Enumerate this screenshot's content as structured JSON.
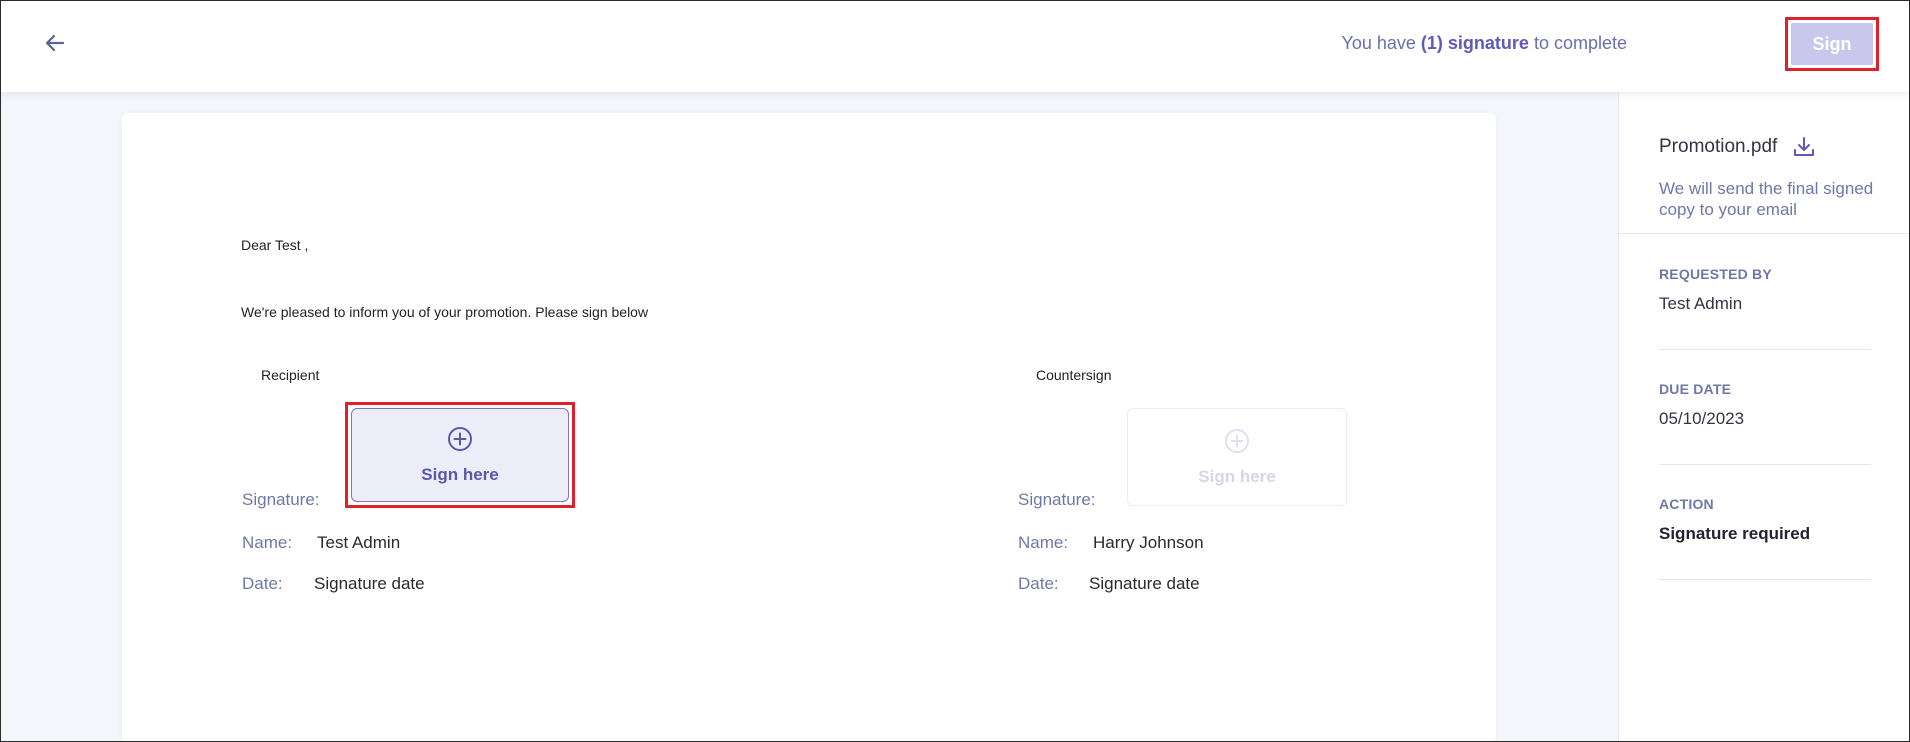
{
  "header": {
    "status_prefix": "You have ",
    "status_count": "(1) signature",
    "status_suffix": " to complete",
    "sign_button": "Sign"
  },
  "document": {
    "greeting": "Dear Test ,",
    "body": "We're pleased to inform you of your promotion. Please sign below",
    "recipient": {
      "title": "Recipient",
      "sign_here": "Sign here",
      "signature_label": "Signature:",
      "name_label": "Name:",
      "name_value": "Test Admin",
      "date_label": "Date:",
      "date_value": "Signature date"
    },
    "countersign": {
      "title": "Countersign",
      "sign_here": "Sign here",
      "signature_label": "Signature:",
      "name_label": "Name:",
      "name_value": "Harry Johnson",
      "date_label": "Date:",
      "date_value": "Signature date"
    }
  },
  "panel": {
    "file_name": "Promotion.pdf",
    "note": "We will send the final signed copy to your email",
    "requested_by_heading": "REQUESTED BY",
    "requested_by_value": "Test Admin",
    "due_date_heading": "DUE DATE",
    "due_date_value": "05/10/2023",
    "action_heading": "ACTION",
    "action_value": "Signature required"
  },
  "icons": {
    "back": "arrow-left-icon",
    "add": "plus-circle-icon",
    "download": "download-icon"
  },
  "colors": {
    "accent": "#5f5ab8",
    "highlight_outline": "#e0202b",
    "sign_button_bg": "#c9c8ec",
    "muted_text": "#6e78a8"
  }
}
